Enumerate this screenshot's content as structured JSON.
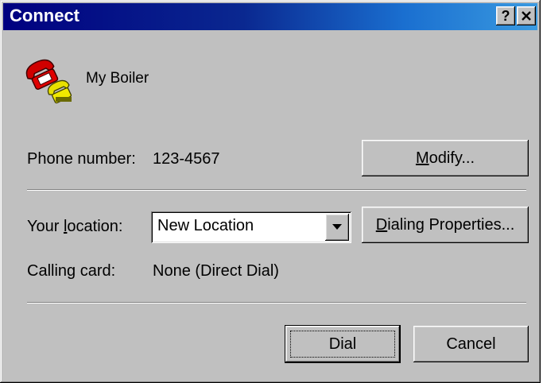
{
  "window": {
    "title": "Connect",
    "help_button": "?",
    "close_button": "✕"
  },
  "connection": {
    "name": "My Boiler",
    "icon": "telephone-icon"
  },
  "phone": {
    "label": "Phone number:",
    "value": "123-4567",
    "modify_button": {
      "pre": "",
      "mnemonic": "M",
      "post": "odify..."
    }
  },
  "location": {
    "label": {
      "pre": "Your ",
      "mnemonic": "l",
      "post": "ocation:"
    },
    "selected": "New Location",
    "dialing_properties_button": {
      "pre": "",
      "mnemonic": "D",
      "post": "ialing Properties..."
    }
  },
  "calling_card": {
    "label": "Calling card:",
    "value": "None (Direct Dial)"
  },
  "actions": {
    "dial": "Dial",
    "cancel": "Cancel"
  }
}
